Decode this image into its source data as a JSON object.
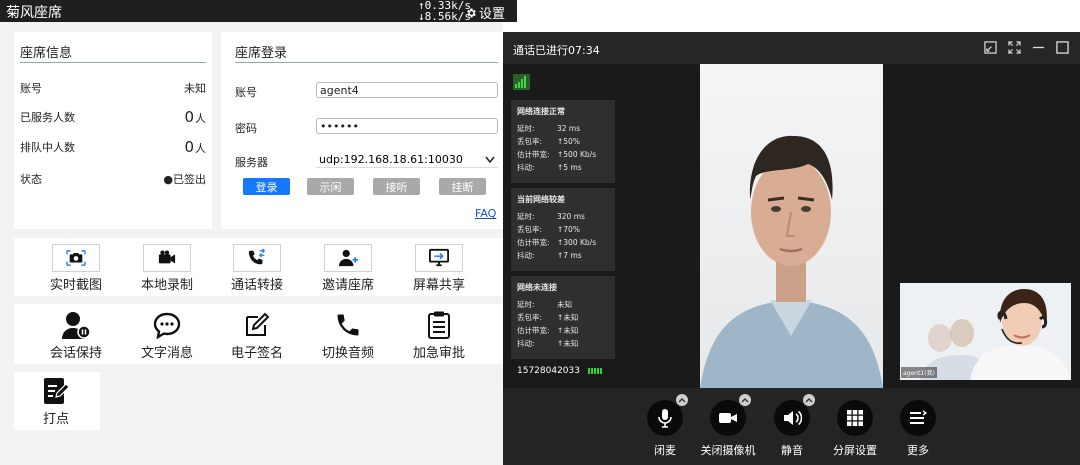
{
  "titlebar": {
    "app_title": "菊风座席",
    "upload_speed": "↑0.33k/s",
    "download_speed": "↓8.56k/s",
    "settings_label": "设置"
  },
  "seat_info": {
    "title": "座席信息",
    "rows": [
      {
        "label": "账号",
        "value": "未知"
      },
      {
        "label": "已服务人数",
        "number": "0",
        "unit": "人"
      },
      {
        "label": "排队中人数",
        "number": "0",
        "unit": "人"
      },
      {
        "label": "状态",
        "value": "●已签出"
      }
    ]
  },
  "login": {
    "title": "座席登录",
    "account_label": "账号",
    "account_value": "agent4",
    "password_label": "密码",
    "password_value": "••••••",
    "server_label": "服务器",
    "server_value": "udp:192.168.18.61:10030",
    "buttons": [
      "登录",
      "示闲",
      "接听",
      "挂断"
    ],
    "faq": "FAQ"
  },
  "tools": [
    {
      "label": "实时截图",
      "icon": "camera-icon"
    },
    {
      "label": "本地录制",
      "icon": "video-record-icon"
    },
    {
      "label": "通话转接",
      "icon": "phone-transfer-icon"
    },
    {
      "label": "邀请座席",
      "icon": "invite-user-icon"
    },
    {
      "label": "屏幕共享",
      "icon": "screen-share-icon"
    },
    {
      "label": "会话保持",
      "icon": "hold-user-icon"
    },
    {
      "label": "文字消息",
      "icon": "chat-icon"
    },
    {
      "label": "电子签名",
      "icon": "signature-icon"
    },
    {
      "label": "切换音频",
      "icon": "phone-icon"
    },
    {
      "label": "加急审批",
      "icon": "clipboard-icon"
    },
    {
      "label": "打点",
      "icon": "mark-icon"
    }
  ],
  "call": {
    "duration": "通话已进行07:34",
    "stats": [
      {
        "title": "网络连接正常",
        "rows": [
          [
            "延时:",
            "32 ms"
          ],
          [
            "丢包率:",
            "↑50%"
          ],
          [
            "估计带宽:",
            "↑500 Kb/s"
          ],
          [
            "抖动:",
            "↑5 ms"
          ]
        ]
      },
      {
        "title": "当前网络较差",
        "rows": [
          [
            "延时:",
            "320 ms"
          ],
          [
            "丢包率:",
            "↑70%"
          ],
          [
            "估计带宽:",
            "↑300 Kb/s"
          ],
          [
            "抖动:",
            "↑7 ms"
          ]
        ]
      },
      {
        "title": "网络未连接",
        "rows": [
          [
            "延时:",
            "未知"
          ],
          [
            "丢包率:",
            "↑未知"
          ],
          [
            "估计带宽:",
            "↑未知"
          ],
          [
            "抖动:",
            "↑未知"
          ]
        ]
      }
    ],
    "phone_number": "15728042033",
    "pip_label": "agent1(我)",
    "controls": [
      {
        "label": "闭麦",
        "icon": "microphone-icon"
      },
      {
        "label": "关闭摄像机",
        "icon": "camera-video-icon"
      },
      {
        "label": "静音",
        "icon": "speaker-icon"
      },
      {
        "label": "分屏设置",
        "icon": "grid-icon"
      },
      {
        "label": "更多",
        "icon": "more-menu-icon"
      }
    ]
  },
  "colors": {
    "primary": "#1677ff",
    "danger": "#d9001b",
    "signal": "#3cdc3c",
    "dark_bg": "#1e1e1e"
  }
}
